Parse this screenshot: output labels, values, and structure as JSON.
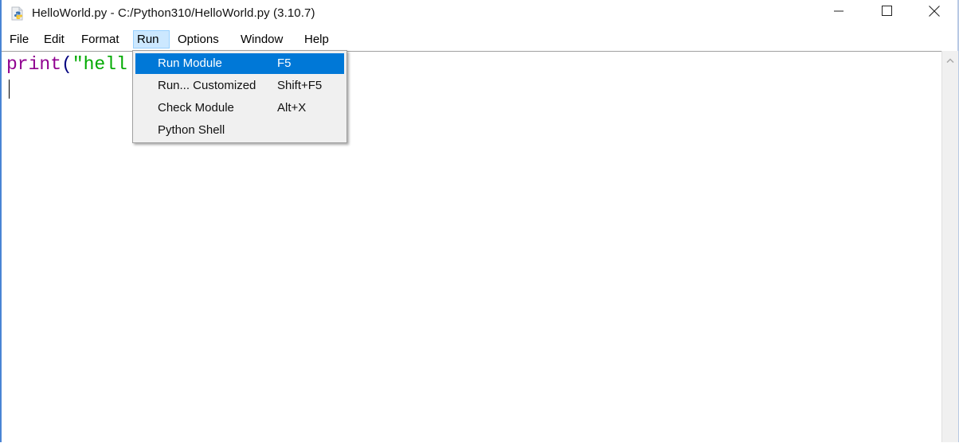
{
  "window": {
    "title": "HelloWorld.py - C:/Python310/HelloWorld.py (3.10.7)",
    "app_icon": "python-file-icon",
    "controls": [
      {
        "name": "minimize",
        "icon": "minimize-icon"
      },
      {
        "name": "maximize",
        "icon": "maximize-icon"
      },
      {
        "name": "close",
        "icon": "close-icon"
      }
    ]
  },
  "menubar": {
    "items": [
      {
        "label": "File"
      },
      {
        "label": "Edit"
      },
      {
        "label": "Format"
      },
      {
        "label": "Run",
        "active": true
      },
      {
        "label": "Options"
      },
      {
        "label": "Window"
      },
      {
        "label": "Help"
      }
    ]
  },
  "editor": {
    "visible_code": {
      "builtin": "print",
      "paren": "(",
      "string": "\"hell"
    },
    "colors": {
      "builtin": "#900090",
      "string": "#00aa00",
      "paren": "#000080"
    }
  },
  "run_menu": {
    "items": [
      {
        "label": "Run Module",
        "accelerator": "F5",
        "highlighted": true
      },
      {
        "label": "Run... Customized",
        "accelerator": "Shift+F5"
      },
      {
        "label": "Check Module",
        "accelerator": "Alt+X"
      },
      {
        "label": "Python Shell",
        "accelerator": ""
      }
    ],
    "highlight_color": "#0078d7"
  },
  "scrollbar": {
    "up_icon": "chevron-up-icon"
  }
}
